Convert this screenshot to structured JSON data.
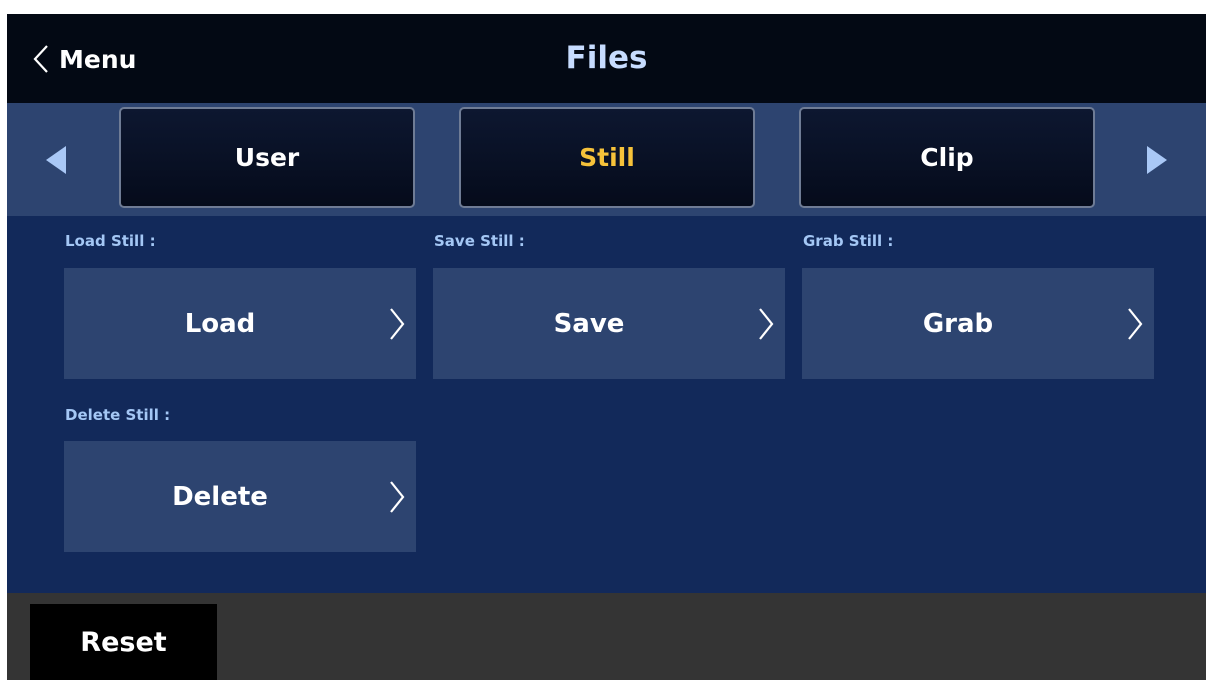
{
  "header": {
    "back_label": "Menu",
    "title": "Files"
  },
  "tabs": {
    "items": [
      {
        "label": "User",
        "active": false
      },
      {
        "label": "Still",
        "active": true
      },
      {
        "label": "Clip",
        "active": false
      }
    ],
    "prev_icon": "triangle-left-icon",
    "next_icon": "triangle-right-icon"
  },
  "sections": {
    "load": {
      "label": "Load Still :",
      "button": "Load"
    },
    "save": {
      "label": "Save Still :",
      "button": "Save"
    },
    "grab": {
      "label": "Grab Still :",
      "button": "Grab"
    },
    "delete": {
      "label": "Delete Still :",
      "button": "Delete"
    }
  },
  "footer": {
    "reset_label": "Reset"
  },
  "colors": {
    "header_bg": "#030914",
    "title": "#c7dcff",
    "panel_bg": "#12295a",
    "tile_bg": "#2d4470",
    "active_tab": "#f6c23a",
    "field_label": "#a4c7f5",
    "arrow": "#a9c8f6",
    "footer_bg": "#343434"
  }
}
